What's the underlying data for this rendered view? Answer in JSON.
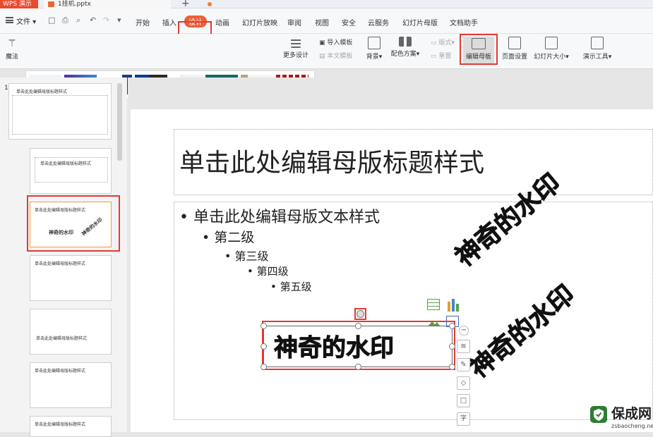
{
  "window": {
    "app_tab": "WPS 演示",
    "file_tab": "1挂机.pptx",
    "plus": "+"
  },
  "menubar": {
    "file_label": "文件",
    "items": [
      "开始",
      "插入",
      "设计",
      "动画",
      "幻灯片放映",
      "审阅",
      "视图",
      "安全",
      "云服务",
      "幻灯片母版",
      "文档助手"
    ],
    "active": "设计"
  },
  "ribbon": {
    "magic_label": "魔法",
    "more_design": "更多设计",
    "import_template": "导入模板",
    "this_template": "本文模板",
    "background": "背景",
    "color_scheme": "配色方案",
    "layout": "版式",
    "reset": "重置",
    "edit_master": "编辑母板",
    "page_setup": "页面设置",
    "slide_size": "幻灯片大小",
    "presentation_tools": "演示工具"
  },
  "thumbnails": {
    "slide_number": "1",
    "master_title": "单击此处编辑母版标题样式",
    "layout_title": "单击此处编辑母版标题样式",
    "wm_a": "神奇的水印",
    "wm_b": "神奇的水印"
  },
  "slide": {
    "title": "单击此处编辑母版标题样式",
    "level1": "单击此处编辑母版文本样式",
    "level2": "第二级",
    "level3": "第三级",
    "level4": "第四级",
    "level5": "第五级",
    "watermark_main": "神奇的水印",
    "watermark_rot1": "神奇的水印",
    "watermark_rot2": "神奇的水印"
  },
  "logo": {
    "name": "保成网",
    "url": "zsbaocheng.net"
  },
  "colors": {
    "accent": "#e8623a",
    "highlight_border": "#e53935",
    "logo_green": "#2e7d32"
  }
}
